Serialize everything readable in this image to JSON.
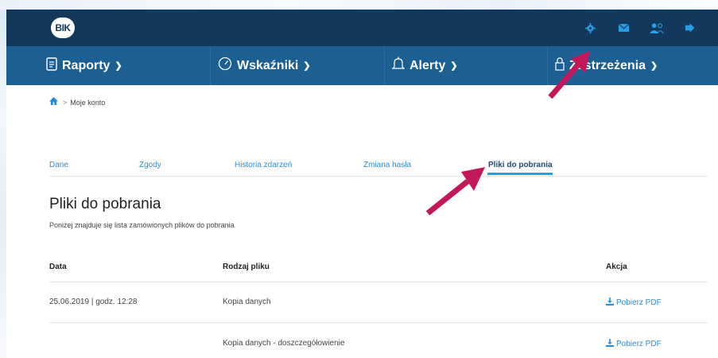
{
  "brand": {
    "logo_text": "BIK"
  },
  "top_icons": [
    "gear-icon",
    "envelope-icon",
    "users-icon",
    "logout-icon"
  ],
  "nav": [
    {
      "label": "Raporty",
      "icon": "document-icon"
    },
    {
      "label": "Wskaźniki",
      "icon": "gauge-icon"
    },
    {
      "label": "Alerty",
      "icon": "bell-icon"
    },
    {
      "label": "Zastrzeżenia",
      "icon": "lock-icon"
    }
  ],
  "breadcrumb": {
    "current": "Moje konto"
  },
  "tabs": [
    {
      "label": "Dane"
    },
    {
      "label": "Zgody"
    },
    {
      "label": "Historia zdarzeń"
    },
    {
      "label": "Zmiana hasła"
    },
    {
      "label": "Pliki do pobrania",
      "active": true
    }
  ],
  "page": {
    "title": "Pliki do pobrania",
    "subtitle": "Poniżej znajduje się lista zamówionych plików do pobrania"
  },
  "table": {
    "headers": {
      "date": "Data",
      "type": "Rodzaj pliku",
      "action": "Akcja"
    },
    "rows": [
      {
        "date": "25.06.2019  |  godz. 12:28",
        "type": "Kopia danych",
        "action": "Pobierz PDF"
      },
      {
        "date": "",
        "type": "Kopia danych - doszczegółowienie",
        "action": "Pobierz PDF"
      }
    ]
  },
  "colors": {
    "topbar": "#12385c",
    "navbar": "#1b5f93",
    "accent": "#2a9ee5",
    "annotation_arrow": "#c2185b"
  }
}
